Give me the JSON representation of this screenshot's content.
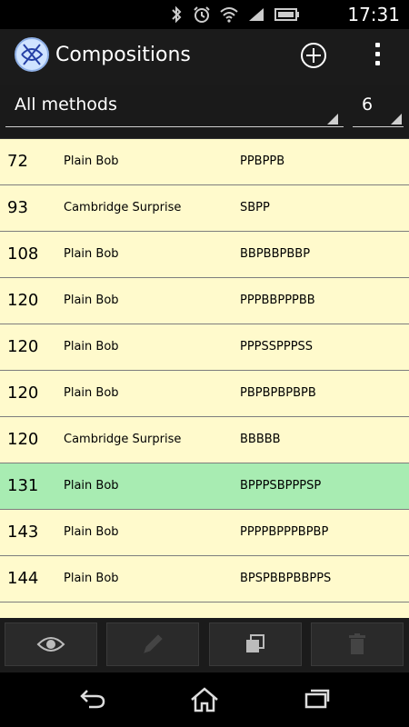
{
  "status": {
    "time": "17:31"
  },
  "app": {
    "title": "Compositions"
  },
  "filter": {
    "method": "All methods",
    "count": "6"
  },
  "rows": [
    {
      "length": "72",
      "method": "Plain Bob",
      "calls": "PPBPPB"
    },
    {
      "length": "93",
      "method": "Cambridge Surprise",
      "calls": "SBPP"
    },
    {
      "length": "108",
      "method": "Plain Bob",
      "calls": "BBPBBPBBP"
    },
    {
      "length": "120",
      "method": "Plain Bob",
      "calls": "PPPBBPPPBB"
    },
    {
      "length": "120",
      "method": "Plain Bob",
      "calls": "PPPSSPPPSS"
    },
    {
      "length": "120",
      "method": "Plain Bob",
      "calls": "PBPBPBPBPB"
    },
    {
      "length": "120",
      "method": "Cambridge Surprise",
      "calls": "BBBBB"
    },
    {
      "length": "131",
      "method": "Plain Bob",
      "calls": "BPPPSBPPPSP",
      "selected": true
    },
    {
      "length": "143",
      "method": "Plain Bob",
      "calls": "PPPPBPPPBPBP"
    },
    {
      "length": "144",
      "method": "Plain Bob",
      "calls": "BPSPBBPBBPPS"
    },
    {
      "length": "",
      "method": "",
      "calls": ""
    }
  ],
  "toolbar": {
    "view_icon": "eye-icon",
    "edit_icon": "pencil-icon",
    "copy_icon": "copy-icon",
    "delete_icon": "trash-icon"
  }
}
